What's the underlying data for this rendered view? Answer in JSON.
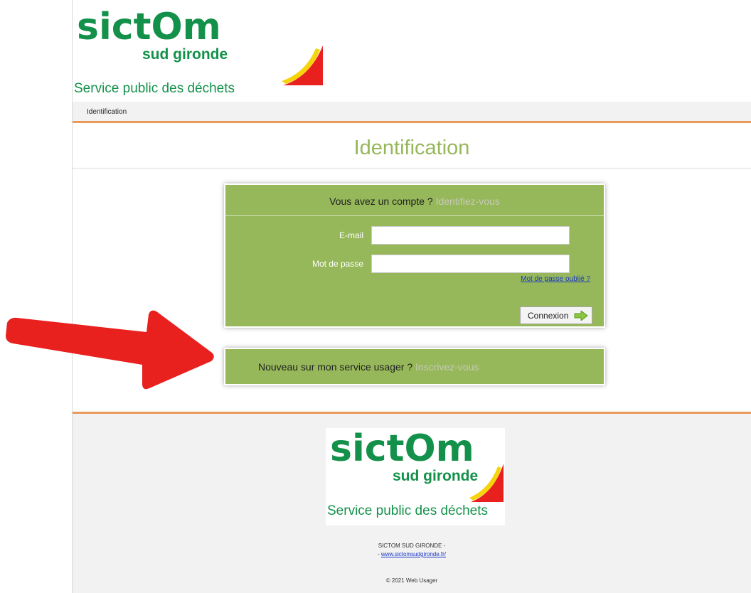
{
  "header": {
    "logo_word": "sictOm",
    "logo_sub": "sud gironde",
    "logo_tagline": "Service public des déchets"
  },
  "breadcrumb": "Identification",
  "page_title": "Identification",
  "login": {
    "prompt": "Vous avez un compte ?",
    "prompt_link": "Identifiez-vous",
    "email_label": "E-mail",
    "email_value": "",
    "password_label": "Mot de passe",
    "password_value": "",
    "forgot_link": "Mot de passe oublié ?",
    "submit_label": "Connexion"
  },
  "signup": {
    "prompt": "Nouveau sur mon service usager ?",
    "link": "Inscrivez-vous"
  },
  "footer": {
    "logo_word": "sictOm",
    "logo_sub": "sud gironde",
    "logo_tagline": "Service public des déchets",
    "org_name": "SICTOM SUD GIRONDE -",
    "site_prefix": "-",
    "site_url": "www.sictomsudgironde.fr/",
    "copyright": "© 2021 Web Usager"
  },
  "colors": {
    "panel_green": "#96b85a",
    "brand_green": "#13914a",
    "accent_orange": "#ec9a5a",
    "annotation_red": "#e8211f"
  }
}
